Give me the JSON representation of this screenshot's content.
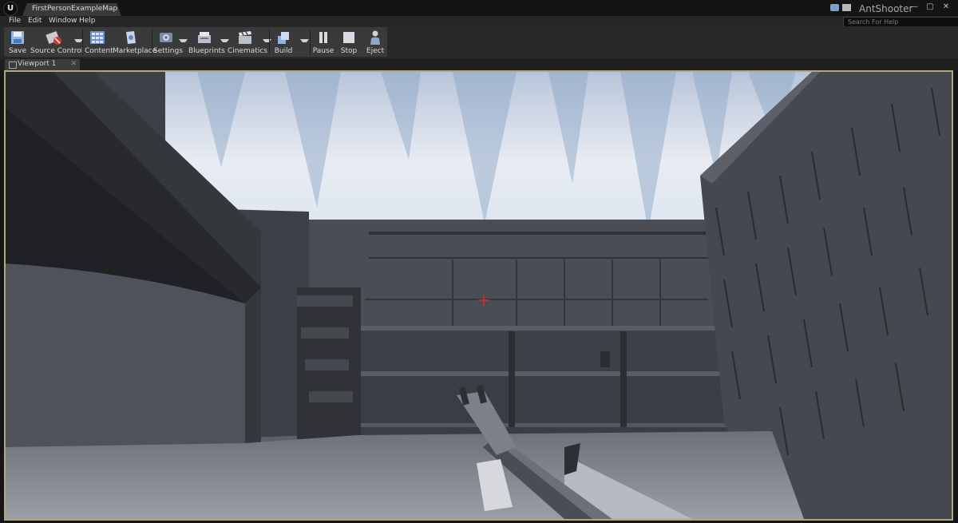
{
  "title_bar": {
    "map_tab": "FirstPersonExampleMap",
    "project_name": "AntShooter",
    "window_controls": [
      "minimize",
      "maximize",
      "close"
    ]
  },
  "menu": {
    "items": [
      "File",
      "Edit",
      "Window",
      "Help"
    ],
    "search_placeholder": "Search For Help"
  },
  "toolbar": {
    "buttons": [
      {
        "label": "Save",
        "icon": "save-icon"
      },
      {
        "label": "Source Control",
        "icon": "source-control-icon"
      },
      {
        "label": "Content",
        "icon": "content-icon"
      },
      {
        "label": "Marketplace",
        "icon": "marketplace-icon"
      },
      {
        "label": "Settings",
        "icon": "settings-icon"
      },
      {
        "label": "Blueprints",
        "icon": "blueprints-icon"
      },
      {
        "label": "Cinematics",
        "icon": "cinematics-icon"
      },
      {
        "label": "Build",
        "icon": "build-icon"
      },
      {
        "label": "Pause",
        "icon": "pause-icon"
      },
      {
        "label": "Stop",
        "icon": "stop-icon"
      },
      {
        "label": "Eject",
        "icon": "eject-icon"
      }
    ]
  },
  "viewport": {
    "tab_label": "Viewport 1",
    "crosshair_color": "#d23030",
    "frame_color": "#b5a57a"
  }
}
